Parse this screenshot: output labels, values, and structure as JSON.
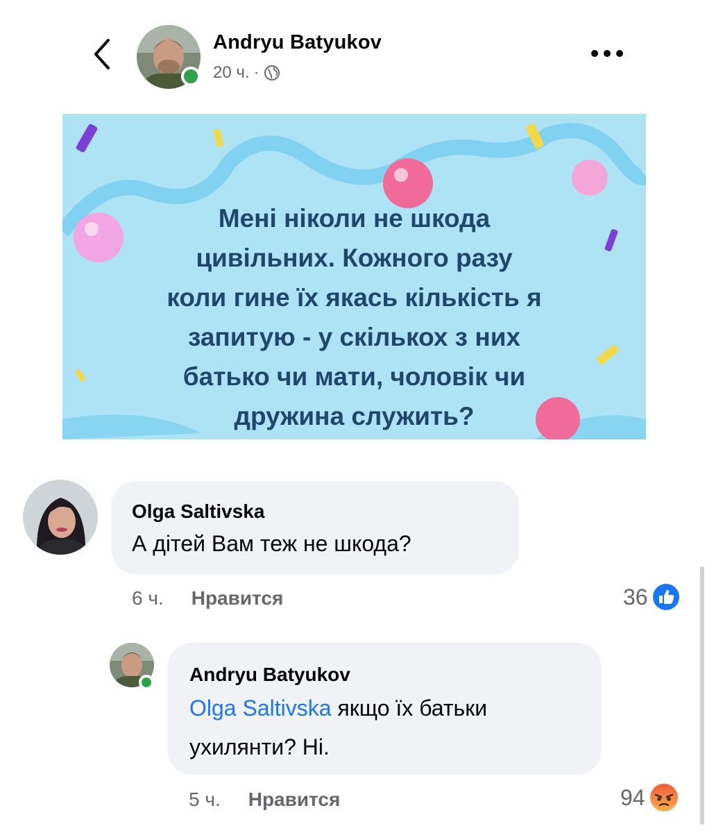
{
  "header": {
    "author": "Andryu Batyukov",
    "time": "20 ч.",
    "separator": "·"
  },
  "post": {
    "text": "Мені ніколи не шкода цивільних. Кожного разу коли гине їх якась кількість я запитую - у скількох з них батько чи мати, чоловік чи дружина служить?",
    "lines": [
      "Мені ніколи не шкода",
      "цивільних. Кожного разу",
      "коли гине їх якась кількість я",
      "запитую - у скількох з них",
      "батько чи мати, чоловік чи",
      "дружина служить?"
    ]
  },
  "comments": [
    {
      "author": "Olga Saltivska",
      "text": "А дітей Вам теж не шкода?",
      "time": "6 ч.",
      "like_label": "Нравится",
      "reaction_count": "36",
      "reaction_icon": "like-icon"
    },
    {
      "author": "Andryu Batyukov",
      "mention": "Olga Saltivska",
      "text_line1": " якщо їх батьки",
      "text_line2": "ухилянти? Ні.",
      "time": "5 ч.",
      "like_label": "Нравится",
      "reaction_count": "94",
      "reaction_icon": "angry-icon"
    }
  ],
  "colors": {
    "post_background": "#aee3f6",
    "post_text": "#21466d",
    "mention": "#1877f2",
    "online": "#31a24c",
    "bubble": "#f0f2f5"
  }
}
